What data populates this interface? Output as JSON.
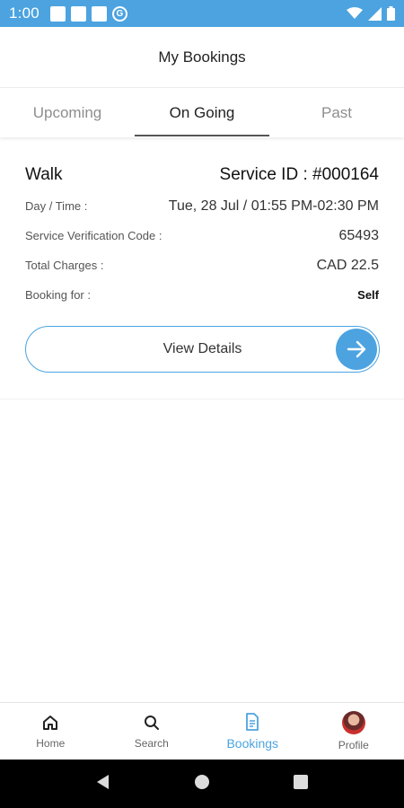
{
  "status_bar": {
    "time": "1:00"
  },
  "header": {
    "title": "My Bookings"
  },
  "tabs": [
    {
      "label": "Upcoming"
    },
    {
      "label": "On Going"
    },
    {
      "label": "Past"
    }
  ],
  "booking": {
    "service_name": "Walk",
    "service_id": "Service ID : #000164",
    "rows": [
      {
        "label": "Day / Time :",
        "value": "Tue, 28 Jul / 01:55 PM-02:30 PM"
      },
      {
        "label": "Service Verification Code :",
        "value": "65493"
      },
      {
        "label": "Total Charges :",
        "value": "CAD 22.5"
      },
      {
        "label": "Booking for :",
        "value": "Self"
      }
    ],
    "view_details_label": "View Details"
  },
  "bottom_nav": [
    {
      "label": "Home",
      "icon": "home-icon"
    },
    {
      "label": "Search",
      "icon": "search-icon"
    },
    {
      "label": "Bookings",
      "icon": "document-icon"
    },
    {
      "label": "Profile",
      "icon": "avatar"
    }
  ],
  "colors": {
    "accent": "#4ca3e0",
    "system_nav": "#000000"
  }
}
